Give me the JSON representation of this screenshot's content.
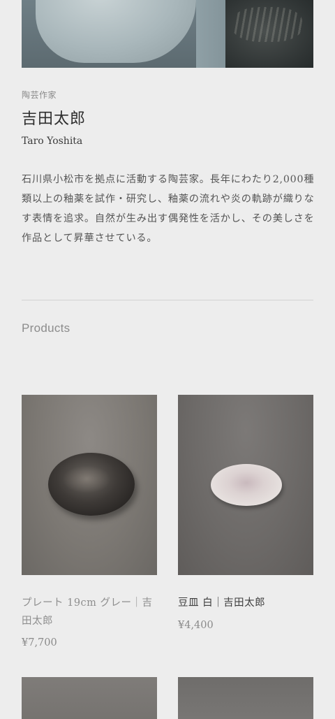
{
  "artist": {
    "role": "陶芸作家",
    "name_ja": "吉田太郎",
    "name_en": "Taro Yoshita",
    "bio": "石川県小松市を拠点に活動する陶芸家。長年にわたり2,000種類以上の釉薬を試作・研究し、釉薬の流れや炎の軌跡が織りなす表情を追求。自然が生み出す偶発性を活かし、その美しさを作品として昇華させている。"
  },
  "products_section": {
    "title": "Products"
  },
  "products": [
    {
      "title": "プレート 19cm グレー｜吉田太郎",
      "price": "¥7,700"
    },
    {
      "title": "豆皿 白｜吉田太郎",
      "price": "¥4,400"
    }
  ]
}
